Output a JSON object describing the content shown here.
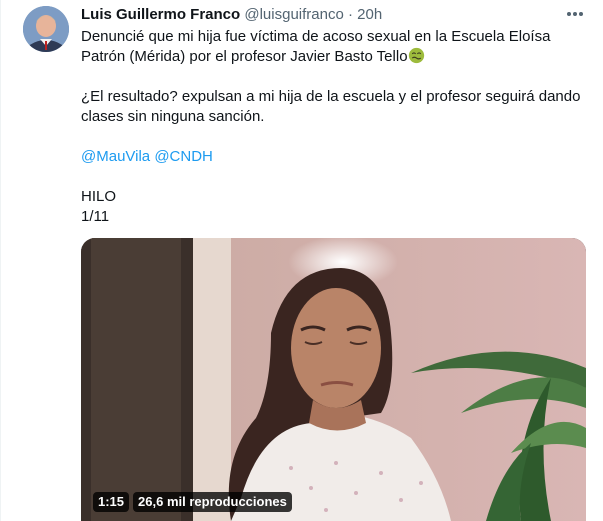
{
  "tweet": {
    "author_name": "Luis Guillermo Franco",
    "author_handle": "@luisguifranco",
    "separator": "·",
    "timestamp": "20h",
    "line1": "Denuncié que mi hija fue víctima de acoso sexual en la Escuela Eloísa Patrón (Mérida) por el profesor Javier Basto Tello",
    "emoji_icon": "nauseated-face-emoji",
    "line2": "¿El resultado? expulsan a mi hija de la escuela y el profesor seguirá dando clases sin ninguna sanción.",
    "mentions": [
      "@MauVila",
      "@CNDH"
    ],
    "thread_label": "HILO",
    "thread_count": "1/11"
  },
  "video": {
    "duration": "1:15",
    "views": "26,6 mil reproducciones"
  },
  "icons": {
    "more": "more-options-icon"
  }
}
